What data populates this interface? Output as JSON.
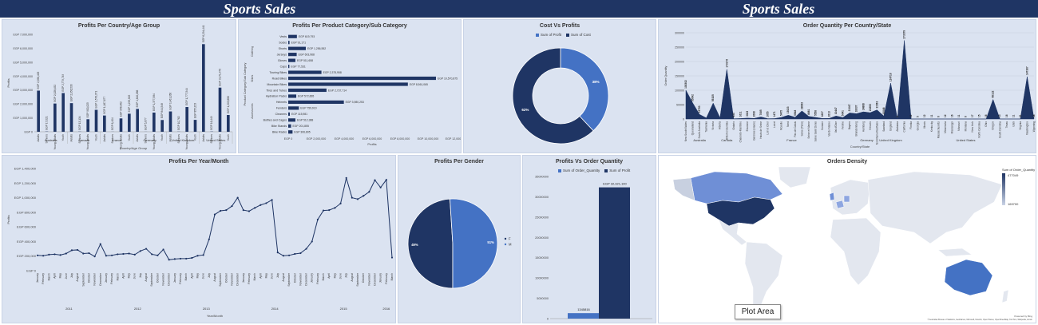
{
  "dashboard": {
    "title_left": "Sports Sales",
    "title_right": "Sports Sales",
    "plot_area_tooltip": "Plot Area",
    "colors": {
      "banner": "#1f3564",
      "panel": "#dbe3f1",
      "dark": "#1f3564",
      "mid": "#4472c4",
      "light": "#6f8fd6"
    }
  },
  "chart_data": [
    {
      "id": "country_age",
      "type": "bar",
      "title": "Profits Per Country/Age Group",
      "xlabel": "Country/Age Group",
      "ylabel": "Profits",
      "ylim": [
        0,
        7000000
      ],
      "yticks": [
        "EGP 0",
        "EGP 1,000,000",
        "EGP 2,000,000",
        "EGP 3,000,000",
        "EGP 4,000,000",
        "EGP 5,000,000",
        "EGP 6,000,000",
        "EGP 7,000,000"
      ],
      "groups": [
        {
          "name": "Australia",
          "categories": [
            "Adults",
            "Seniors",
            "Young Adults",
            "Youth"
          ],
          "values": [
            2956405,
            17021,
            2028452,
            2779749
          ],
          "labels": [
            "EGP 2,956,405",
            "EGP 17,021",
            "EGP 2,028,452",
            "EGP 2,779,749"
          ]
        },
        {
          "name": "Canada",
          "categories": [
            "Adults",
            "Seniors",
            "Young Adults",
            "Youth"
          ],
          "values": [
            2056530,
            13134,
            900025,
            1576371
          ],
          "labels": [
            "EGP 2,056,530",
            "EGP 13,134",
            "EGP 900,025",
            "EGP 1,576,371"
          ]
        },
        {
          "name": "France",
          "categories": [
            "Adults",
            "Seniors",
            "Young Adults",
            "Youth"
          ],
          "values": [
            1167677,
            6404,
            958462,
            1295845
          ],
          "labels": [
            "EGP 1,167,677",
            "EGP 6,404",
            "EGP 958,462",
            "EGP 1,295,845"
          ]
        },
        {
          "name": "Germany",
          "categories": [
            "Adults",
            "Seniors",
            "Young Adults",
            "Youth"
          ],
          "values": [
            1640086,
            5877,
            1377584,
            844548
          ],
          "labels": [
            "EGP 1,640,086",
            "EGP 5,877",
            "EGP 1,377,584",
            "EGP 844,548"
          ]
        },
        {
          "name": "United Kingdom",
          "categories": [
            "Adults",
            "Seniors",
            "Young Adults",
            "Youth"
          ],
          "values": [
            1461260,
            10762,
            1777544,
            855223
          ],
          "labels": [
            "EGP 1,461,260",
            "EGP 10,762",
            "EGP 1,777,544",
            "EGP 855,223"
          ]
        },
        {
          "name": "United States",
          "categories": [
            "Adults",
            "Seniors",
            "Young Adults",
            "Youth"
          ],
          "values": [
            6294441,
            16449,
            3171470,
            1203886
          ],
          "labels": [
            "EGP 6,294,441",
            "EGP 16,449",
            "EGP 3,171,470",
            "EGP 1,203,886"
          ]
        }
      ]
    },
    {
      "id": "category",
      "type": "bar",
      "orientation": "horizontal",
      "title": "Profits Per Product Category/Sub Category",
      "xlabel": "Profits",
      "ylabel": "Product Category/Sub Category",
      "xlim": [
        0,
        12000000
      ],
      "xticks": [
        "EGP 0",
        "EGP 2,000,000",
        "EGP 4,000,000",
        "EGP 6,000,000",
        "EGP 8,000,000",
        "EGP 10,000,000",
        "EGP 12,000,000"
      ],
      "group_labels": [
        "Clothing",
        "Bikes",
        "Accessories"
      ],
      "categories": [
        "Vests",
        "Socks",
        "Shorts",
        "Jerseys",
        "Gloves",
        "Caps",
        "Touring Bikes",
        "Road Bikes",
        "Mountain Bikes",
        "Tires and Tubes",
        "Hydration Packs",
        "Helmets",
        "Fenders",
        "Cleaners",
        "Bottles and Cages",
        "Bike Stands",
        "Bike Racks"
      ],
      "values": [
        619793,
        91171,
        1256552,
        603968,
        511658,
        77531,
        2375958,
        10570875,
        8561065,
        2737714,
        572665,
        3980253,
        759910,
        115981,
        512388,
        201855,
        306805
      ],
      "labels": [
        "EGP 619,793",
        "EGP 91,171",
        "EGP 1,256,552",
        "EGP 603,968",
        "EGP 511,658",
        "EGP 77,531",
        "EGP 2,375,958",
        "EGP 10,570,875",
        "EGP 8,561,065",
        "EGP 2,737,714",
        "EGP 572,665",
        "EGP 3,980,253",
        "EGP 759,910",
        "EGP 115,981",
        "EGP 512,388",
        "EGP 201,855",
        "EGP 306,805"
      ]
    },
    {
      "id": "cost_profit",
      "type": "pie",
      "donut": true,
      "title": "Cost Vs Profits",
      "legend": [
        "Sum of Profit",
        "Sum of Cost"
      ],
      "values": [
        38,
        62
      ],
      "labels": [
        "38%",
        "62%"
      ]
    },
    {
      "id": "order_qty",
      "type": "area",
      "title": "Order Quantity Per Country/State",
      "xlabel": "Country/State",
      "ylabel": "Order Quantity",
      "ylim": [
        0,
        300000
      ],
      "yticks": [
        "0",
        "50000",
        "100000",
        "150000",
        "200000",
        "250000",
        "300000"
      ],
      "states": [
        "New South Wales",
        "Queensland",
        "South Australia",
        "Tasmania",
        "Victoria",
        "Alberta",
        "British Columbia",
        "Ontario",
        "Charente-Maritime",
        "Essonne",
        "Garonne (Haute)",
        "Hauts de Seine",
        "Loir et Cher",
        "Loiret",
        "Moselle",
        "Nord",
        "Pas de Calais",
        "Seine (Paris)",
        "Seine et Marne",
        "Seine Saint Denis",
        "Somme",
        "Val de Marne",
        "Val d'Oise",
        "Yveline",
        "Bayern",
        "Brandenburg",
        "Hamburg",
        "Hessen",
        "Nordrhein-Westfalen",
        "Saarland",
        "England",
        "Alabama",
        "California",
        "Florida",
        "Georgia",
        "Illinois",
        "Kentucky",
        "Massachusetts",
        "Minnesota",
        "Mississippi",
        "Missouri",
        "Montana",
        "New York",
        "North Carolina",
        "Ohio",
        "Oregon",
        "South Carolina",
        "Texas",
        "Utah",
        "Virginia",
        "Washington",
        "Wyoming"
      ],
      "values": [
        100302,
        55542,
        15793,
        3500,
        55325,
        4000,
        173176,
        933,
        1611,
        3023,
        2008,
        7085,
        1055,
        1471,
        5475,
        13023,
        5948,
        28043,
        8881,
        5558,
        1807,
        2013,
        10447,
        5041,
        21047,
        18337,
        24868,
        21860,
        31563,
        10048,
        124718,
        4,
        273379,
        11,
        5,
        12,
        11,
        6,
        12,
        16,
        11,
        6,
        17,
        15,
        16,
        68122,
        13,
        16,
        11,
        31,
        147307,
        18
      ],
      "labels": [
        "100302",
        "55542",
        "15793",
        "",
        "55325",
        "",
        "173176",
        "933",
        "1611",
        "3023",
        "2008",
        "7085",
        "1055",
        "1471",
        "5475",
        "13023",
        "5948",
        "28043",
        "8881",
        "5558",
        "1807",
        "2013",
        "10447",
        "5041",
        "21047",
        "18337",
        "24868",
        "21860",
        "31563",
        "10048",
        "124718",
        "4",
        "273379",
        "11",
        "5",
        "12",
        "11",
        "6",
        "12",
        "16",
        "11",
        "6",
        "17",
        "15",
        "16",
        "68122",
        "13",
        "16",
        "11",
        "31",
        "147307",
        "18"
      ],
      "groups": [
        {
          "name": "Australia",
          "from": 0,
          "to": 4
        },
        {
          "name": "Canada",
          "from": 5,
          "to": 7
        },
        {
          "name": "France",
          "from": 8,
          "to": 23
        },
        {
          "name": "Germany",
          "from": 24,
          "to": 29
        },
        {
          "name": "United Kingdom",
          "from": 30,
          "to": 30
        },
        {
          "name": "United States",
          "from": 31,
          "to": 51
        }
      ]
    },
    {
      "id": "year_month",
      "type": "line",
      "title": "Profits Per Year/Month",
      "xlabel": "Year/Month",
      "ylabel": "Profits",
      "ylim": [
        0,
        1400000
      ],
      "yticks": [
        "EGP 0",
        "EGP 200,000",
        "EGP 400,000",
        "EGP 600,000",
        "EGP 800,000",
        "EGP 1,000,000",
        "EGP 1,200,000",
        "EGP 1,400,000"
      ],
      "years": [
        "2011",
        "2012",
        "2013",
        "2014",
        "2015",
        "2016"
      ],
      "months": [
        "January",
        "February",
        "March",
        "April",
        "May",
        "June",
        "July",
        "August",
        "September",
        "October",
        "November",
        "December"
      ],
      "values": [
        [
          210000,
          205000,
          220000,
          225000,
          215000,
          235000,
          280000,
          285000,
          235000,
          240000,
          195000,
          365000
        ],
        [
          205000,
          210000,
          225000,
          230000,
          235000,
          220000,
          270000,
          300000,
          225000,
          210000,
          290000,
          150000
        ],
        [
          160000,
          165000,
          165000,
          175000,
          205000,
          215000,
          430000,
          770000,
          820000,
          830000,
          885000,
          1000000
        ],
        [
          830000,
          815000,
          860000,
          900000,
          925000,
          970000,
          250000,
          205000,
          210000,
          230000,
          240000,
          300000
        ],
        [
          400000,
          700000,
          825000,
          830000,
          860000,
          920000,
          1270000,
          1000000,
          980000,
          1025000,
          1080000,
          1240000
        ],
        [
          1140000,
          1245000,
          180000
        ]
      ]
    },
    {
      "id": "gender",
      "type": "pie",
      "title": "Profits Per Gender",
      "legend": [
        "F",
        "M"
      ],
      "values": [
        49,
        51
      ],
      "labels": [
        "49%",
        "51%"
      ]
    },
    {
      "id": "profit_qty",
      "type": "bar",
      "title": "Profits Vs Order Quantity",
      "legend": [
        "Sum of Order_Quantity",
        "Sum of Profit"
      ],
      "ylim": [
        0,
        35000000
      ],
      "yticks": [
        "0",
        "5000000",
        "10000000",
        "15000000",
        "20000000",
        "25000000",
        "30000000",
        "35000000"
      ],
      "series": [
        {
          "name": "Sum of Order_Quantity",
          "values": [
            1345816
          ],
          "label": "1345816"
        },
        {
          "name": "Sum of Profit",
          "values": [
            32321100
          ],
          "label": "EGP 32,321,100"
        }
      ]
    }
  ],
  "map": {
    "title": "Orders Density",
    "legend_title": "Sum of Order_Quantity",
    "legend_max": "477049",
    "legend_min": "169700",
    "attribution_1": "Powered by Bing",
    "attribution_2": "© Australian Bureau of Statistics, GeoNames, Microsoft, Navinfo, Open Places, OpenStreetMap, TomTom, Wikipedia, Zenrin"
  }
}
